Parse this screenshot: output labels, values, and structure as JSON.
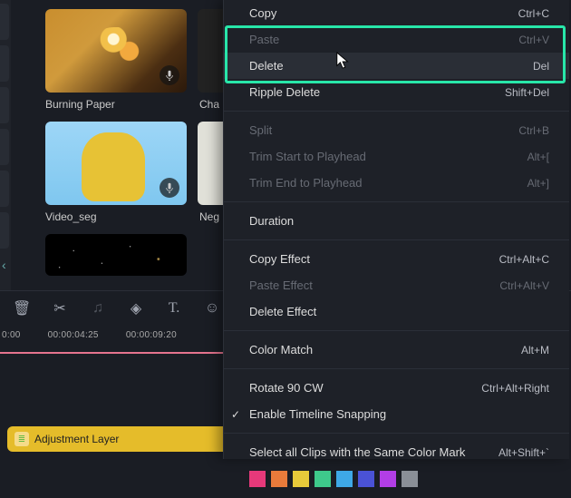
{
  "colors": {
    "accent_highlight": "#28e6a9",
    "timeline_marker": "#e5748e",
    "clip_bg": "#e5bc2a"
  },
  "left_tabs": [
    true,
    true,
    true,
    true,
    true,
    true
  ],
  "media": {
    "items": [
      {
        "label": "Burning Paper",
        "partial_next": "Cha"
      },
      {
        "label": "Video_seg",
        "partial_next": "Neg"
      }
    ]
  },
  "toolbar_icons": [
    "trash",
    "scissors",
    "music-note",
    "tag",
    "text",
    "draw"
  ],
  "ruler": {
    "start": "0:00",
    "ticks": [
      "00:00:04:25",
      "00:00:09:20"
    ]
  },
  "timeline_clip": {
    "label": "Adjustment Layer",
    "icon": "layers-icon"
  },
  "context_menu": {
    "items": [
      {
        "label": "Copy",
        "shortcut": "Ctrl+C",
        "enabled": true
      },
      {
        "label": "Paste",
        "shortcut": "Ctrl+V",
        "enabled": false
      },
      {
        "label": "Delete",
        "shortcut": "Del",
        "enabled": true,
        "hover": true
      },
      {
        "label": "Ripple Delete",
        "shortcut": "Shift+Del",
        "enabled": true
      },
      "sep",
      {
        "label": "Split",
        "shortcut": "Ctrl+B",
        "enabled": false
      },
      {
        "label": "Trim Start to Playhead",
        "shortcut": "Alt+[",
        "enabled": false
      },
      {
        "label": "Trim End to Playhead",
        "shortcut": "Alt+]",
        "enabled": false
      },
      "sep",
      {
        "label": "Duration",
        "shortcut": "",
        "enabled": true
      },
      "sep",
      {
        "label": "Copy Effect",
        "shortcut": "Ctrl+Alt+C",
        "enabled": true
      },
      {
        "label": "Paste Effect",
        "shortcut": "Ctrl+Alt+V",
        "enabled": false
      },
      {
        "label": "Delete Effect",
        "shortcut": "",
        "enabled": true
      },
      "sep",
      {
        "label": "Color Match",
        "shortcut": "Alt+M",
        "enabled": true
      },
      "sep",
      {
        "label": "Rotate 90 CW",
        "shortcut": "Ctrl+Alt+Right",
        "enabled": true
      },
      {
        "label": "Enable Timeline Snapping",
        "shortcut": "",
        "enabled": true,
        "checked": true
      },
      "sep",
      {
        "label": "Select all Clips with the Same Color Mark",
        "shortcut": "Alt+Shift+`",
        "enabled": true
      }
    ],
    "color_marks": [
      "#e6397a",
      "#e97b3b",
      "#e8ca3a",
      "#3ec98b",
      "#3ea8e6",
      "#4a52d6",
      "#b23ee6",
      "#8a8f97"
    ]
  },
  "icons": {
    "chevron_left": "chevron-left-icon",
    "microphone": "microphone-icon",
    "cursor": "cursor-icon",
    "check": "check-icon"
  }
}
